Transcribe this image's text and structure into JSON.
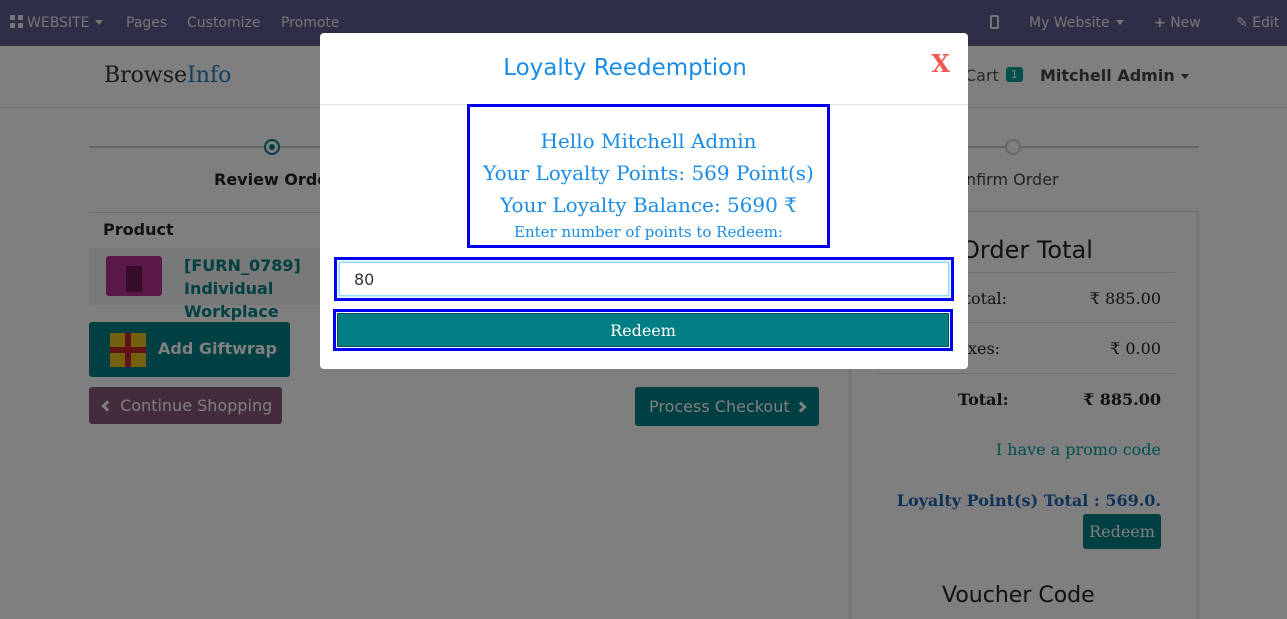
{
  "topbar": {
    "website_label": "WEBSITE",
    "pages_label": "Pages",
    "customize_label": "Customize",
    "promote_label": "Promote",
    "site_selector_label": "My Website",
    "new_label": "New",
    "edit_label": "Edit"
  },
  "header": {
    "logo_part1": "Browse",
    "logo_part2": "Info",
    "cart_label": "Cart",
    "cart_count": "1",
    "user_name": "Mitchell Admin"
  },
  "wizard": {
    "steps": [
      "Review Order",
      "Confirm Order"
    ]
  },
  "cart_table": {
    "header": "Product",
    "items": [
      {
        "name": "[FURN_0789] Individual Workplace"
      }
    ]
  },
  "buttons": {
    "giftwrap": "Add Giftwrap",
    "continue": "Continue Shopping",
    "checkout": "Process Checkout"
  },
  "order_total": {
    "title": "Order Total",
    "subtotal_label": "Subtotal:",
    "subtotal_value": "₹ 885.00",
    "taxes_label": "Taxes:",
    "taxes_value": "₹ 0.00",
    "total_label": "Total:",
    "total_value": "₹ 885.00",
    "promo_link": "I have a promo code",
    "loyalty_total": "Loyalty Point(s) Total : 569.0.",
    "redeem_label": "Redeem",
    "voucher_title": "Voucher Code"
  },
  "modal": {
    "title": "Loyalty Reedemption",
    "close_label": "X",
    "greeting": "Hello Mitchell Admin",
    "points_line": "Your Loyalty Points: 569 Point(s)",
    "balance_line": "Your Loyalty Balance: 5690 ₹",
    "prompt": "Enter number of points to Redeem:",
    "points_value": "80",
    "redeem_button": "Redeem"
  }
}
